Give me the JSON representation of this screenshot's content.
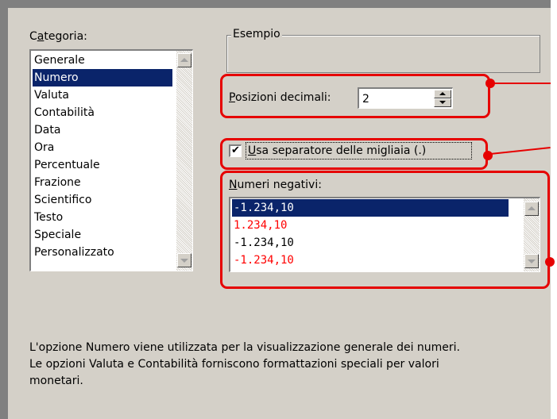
{
  "category": {
    "label_pre": "C",
    "label_key": "a",
    "label_post": "tegoria:",
    "items": [
      "Generale",
      "Numero",
      "Valuta",
      "Contabilità",
      "Data",
      "Ora",
      "Percentuale",
      "Frazione",
      "Scientifico",
      "Testo",
      "Speciale",
      "Personalizzato"
    ],
    "selected_index": 1
  },
  "example": {
    "title": "Esempio",
    "value": ""
  },
  "decimals": {
    "label_key": "P",
    "label_rest": "osizioni decimali:",
    "value": "2"
  },
  "thousands": {
    "label_key": "U",
    "label_rest": "sa separatore delle migliaia (.)",
    "checked": true,
    "check_glyph": "✔"
  },
  "negatives": {
    "label_key": "N",
    "label_rest": "umeri negativi:",
    "items": [
      {
        "text": "-1.234,10",
        "color": "#ffffff"
      },
      {
        "text": "1.234,10",
        "color": "#ff0000"
      },
      {
        "text": "-1.234,10",
        "color": "#000000"
      },
      {
        "text": "-1.234,10",
        "color": "#ff0000"
      }
    ],
    "selected_index": 0
  },
  "description": {
    "line1": "L'opzione Numero viene utilizzata per la visualizzazione generale dei numeri.",
    "line2": "Le opzioni Valuta e Contabilità forniscono formattazioni speciali per valori",
    "line3": "monetari."
  },
  "colors": {
    "panel": "#d4d0c8",
    "selection": "#0a246a",
    "annotation": "#e60000"
  }
}
